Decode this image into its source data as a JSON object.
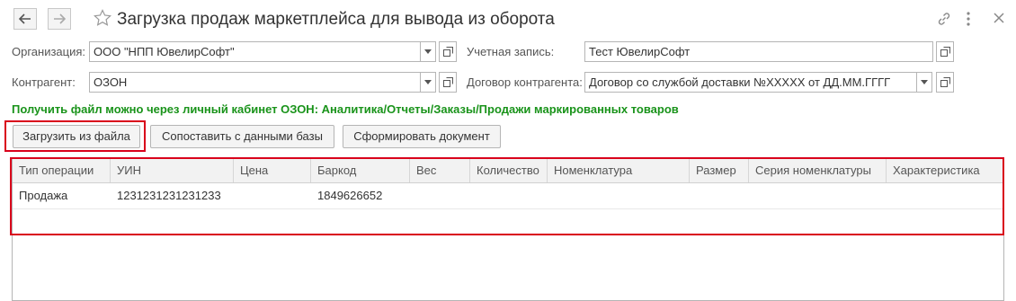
{
  "header": {
    "title": "Загрузка продаж маркетплейса для вывода из оборота"
  },
  "form": {
    "organization": {
      "label": "Организация:",
      "value": "ООО \"НПП ЮвелирСофт\""
    },
    "account": {
      "label": "Учетная запись:",
      "value": "Тест ЮвелирСофт"
    },
    "counterparty": {
      "label": "Контрагент:",
      "value": "ОЗОН"
    },
    "contract": {
      "label": "Договор контрагента:",
      "value": "Договор со службой доставки №XXXXX от ДД.ММ.ГГГГ"
    }
  },
  "hint": "Получить файл можно через личный кабинет ОЗОН: Аналитика/Отчеты/Заказы/Продажи маркированных товаров",
  "toolbar": {
    "load_label": "Загрузить из файла",
    "match_label": "Сопоставить с данными базы",
    "create_label": "Сформировать документ"
  },
  "table": {
    "columns": [
      "Тип операции",
      "УИН",
      "Цена",
      "Баркод",
      "Вес",
      "Количество",
      "Номенклатура",
      "Размер",
      "Серия номенклатуры",
      "Характеристика"
    ],
    "rows": [
      [
        "Продажа",
        "1231231231231233",
        "",
        "1849626652",
        "",
        "",
        "",
        "",
        "",
        ""
      ]
    ]
  },
  "colors": {
    "accent_red": "#d9001b",
    "hint_green": "#19931a"
  }
}
